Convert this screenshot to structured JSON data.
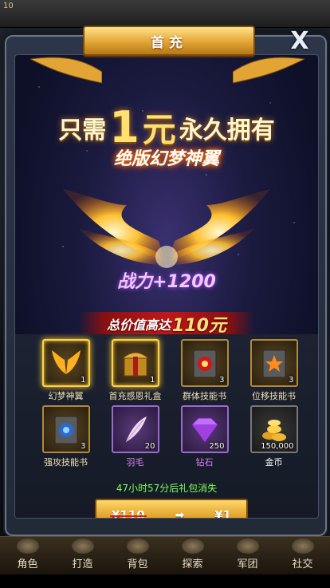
{
  "hud": {
    "level": "10"
  },
  "modal": {
    "title": "首充",
    "close_label": "X",
    "headline_prefix": "只需",
    "headline_amount": "1",
    "headline_unit": "元",
    "headline_suffix": "永久拥有",
    "featured_item": "绝版幻梦神翼",
    "power": "战力+1200",
    "total_value_prefix": "总价值高达",
    "total_value_amount": "110元",
    "countdown": "47小时57分后礼包消失",
    "old_price": "¥110",
    "new_price": "¥1"
  },
  "rewards": [
    {
      "label": "幻梦神翼",
      "qty": "1",
      "icon": "wings-icon"
    },
    {
      "label": "首充感恩礼盒",
      "qty": "1",
      "icon": "gift-chest-icon"
    },
    {
      "label": "群体技能书",
      "qty": "3",
      "icon": "red-skill-book-icon"
    },
    {
      "label": "位移技能书",
      "qty": "3",
      "icon": "star-skill-book-icon"
    },
    {
      "label": "强攻技能书",
      "qty": "3",
      "icon": "blue-skill-book-icon"
    },
    {
      "label": "羽毛",
      "qty": "20",
      "icon": "feather-icon"
    },
    {
      "label": "钻石",
      "qty": "250",
      "icon": "diamond-icon"
    },
    {
      "label": "金币",
      "qty": "150,000",
      "icon": "gold-coins-icon"
    }
  ],
  "nav": [
    "角色",
    "打造",
    "背包",
    "探索",
    "军团",
    "社交"
  ],
  "colors": {
    "gold": "#e2a434",
    "countdown_green": "#7cff5a",
    "purple_label": "#e080ff"
  }
}
